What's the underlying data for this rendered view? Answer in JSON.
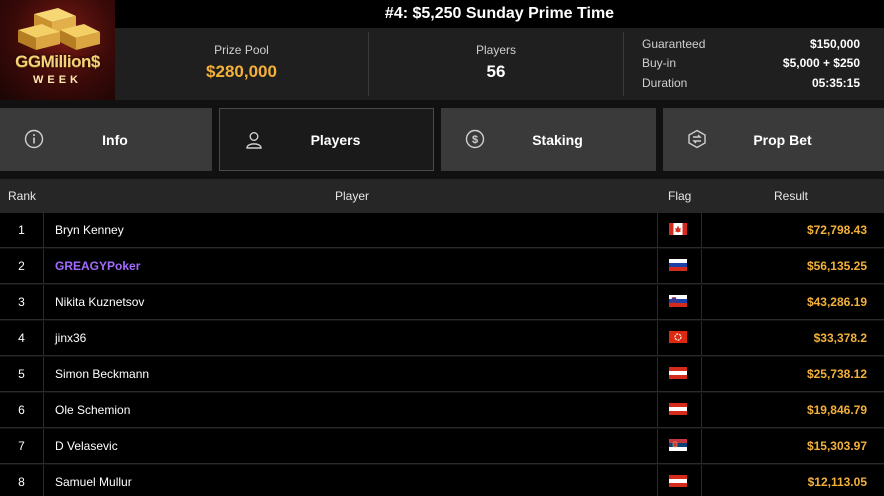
{
  "logo": {
    "brand": "GGMillion$",
    "subtitle": "WEEK"
  },
  "header": {
    "title": "#4: $5,250 Sunday Prime Time"
  },
  "stats": {
    "prize_pool_label": "Prize Pool",
    "prize_pool_value": "$280,000",
    "players_label": "Players",
    "players_value": "56",
    "guaranteed_label": "Guaranteed",
    "guaranteed_value": "$150,000",
    "buyin_label": "Buy-in",
    "buyin_value": "$5,000 + $250",
    "duration_label": "Duration",
    "duration_value": "05:35:15"
  },
  "tabs": [
    {
      "label": "Info",
      "icon": "info-icon"
    },
    {
      "label": "Players",
      "icon": "user-icon"
    },
    {
      "label": "Staking",
      "icon": "dollar-coin-icon"
    },
    {
      "label": "Prop Bet",
      "icon": "prop-bet-icon"
    }
  ],
  "active_tab": "Players",
  "table": {
    "columns": [
      "Rank",
      "Player",
      "Flag",
      "Result"
    ],
    "rows": [
      {
        "rank": "1",
        "player": "Bryn Kenney",
        "flag": "canada-flag",
        "result": "$72,798.43"
      },
      {
        "rank": "2",
        "player": "GREAGYPoker",
        "flag": "russia-flag",
        "result": "$56,135.25"
      },
      {
        "rank": "3",
        "player": "Nikita Kuznetsov",
        "flag": "slovenia-flag",
        "result": "$43,286.19"
      },
      {
        "rank": "4",
        "player": "jinx36",
        "flag": "hong-kong-flag",
        "result": "$33,378.2"
      },
      {
        "rank": "5",
        "player": "Simon Beckmann",
        "flag": "austria-flag",
        "result": "$25,738.12"
      },
      {
        "rank": "6",
        "player": "Ole Schemion",
        "flag": "austria-flag",
        "result": "$19,846.79"
      },
      {
        "rank": "7",
        "player": "D Velasevic",
        "flag": "serbia-flag",
        "result": "$15,303.97"
      },
      {
        "rank": "8",
        "player": "Samuel Mullur",
        "flag": "austria-flag",
        "result": "$12,113.05"
      }
    ]
  },
  "colors": {
    "accent_gold": "#f3b13a",
    "highlight_purple": "#a26bff",
    "background": "#111111"
  }
}
